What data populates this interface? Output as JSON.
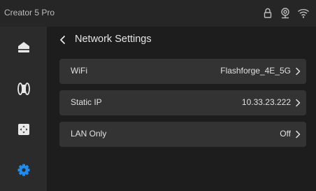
{
  "status_bar": {
    "device_name": "Creator 5 Pro",
    "icons": [
      "lock-icon",
      "webcam-icon",
      "wifi-icon"
    ]
  },
  "sidebar": {
    "items": [
      {
        "name": "home",
        "icon": "home-icon",
        "active": false
      },
      {
        "name": "filament",
        "icon": "filament-spool-icon",
        "active": false
      },
      {
        "name": "controls",
        "icon": "move-axes-icon",
        "active": false
      },
      {
        "name": "settings",
        "icon": "gear-icon",
        "active": true
      }
    ]
  },
  "header": {
    "back_icon": "chevron-left-icon",
    "title": "Network Settings"
  },
  "settings": [
    {
      "label": "WiFi",
      "value": "Flashforge_4E_5G"
    },
    {
      "label": "Static IP",
      "value": "10.33.23.222"
    },
    {
      "label": "LAN Only",
      "value": "Off"
    }
  ],
  "colors": {
    "background": "#1d1d1d",
    "status_bar": "#262626",
    "sidebar": "#2b2b2b",
    "row": "#333333",
    "accent": "#1e8cf0",
    "text": "#e0e0e0"
  }
}
